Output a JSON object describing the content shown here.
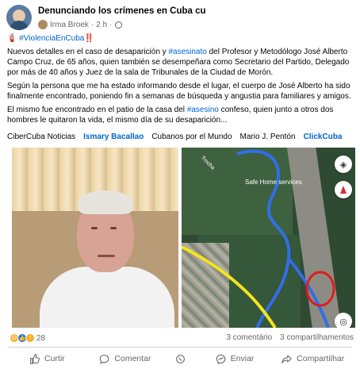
{
  "header": {
    "group_name": "Denunciando los crímenes en Cuba cu",
    "author": "Irma Broek",
    "time": "2 h"
  },
  "post": {
    "hashtag_line": "#ViolenciaEnCuba",
    "emoji_marks": "‼️",
    "paragraph1_a": "Nuevos detalles en el caso de desaparición y ",
    "paragraph1_tag": "#asesinato",
    "paragraph1_b": " del Profesor y Metodólogo José Alberto Campo Cruz, de 65 años, quien también se desempeñara como Secretario del Partido, Delegado por más de 40 años y Juez de la sala de Tribunales de la Ciudad de Morón.",
    "paragraph2": "Según la persona que me ha estado informando desde el lugar, el cuerpo de José Alberto ha sido finalmente encontrado, poniendo fin a semanas de búsqueda y angustia para familiares y amigos.",
    "paragraph3_a": "El mismo fue encontrado en el patio de la casa del  ",
    "paragraph3_tag": "#asesino",
    "paragraph3_b": " confeso, quien junto a otros dos hombres le quitaron la vida, el mismo día de su desaparición..."
  },
  "tags": [
    {
      "label": "CiberCuba Noticias",
      "link": false
    },
    {
      "label": "Ismary Bacallao",
      "link": true
    },
    {
      "label": "Cubanos por el Mundo",
      "link": false
    },
    {
      "label": "Mario J. Pentón",
      "link": false
    },
    {
      "label": "ClickCuba",
      "link": true
    }
  ],
  "map": {
    "place_label": "Safe Home services",
    "road_label": "Trocha"
  },
  "reactions": {
    "count": "28",
    "comments": "3 comentário",
    "shares": "3 compartilhamentos"
  },
  "actions": {
    "like": "Curtir",
    "comment": "Comentar",
    "send": "Enviar",
    "share": "Compartilhar"
  },
  "colors": {
    "link": "#0064d1",
    "muted": "#65676b",
    "route_blue": "#2f6fe8",
    "route_yellow": "#f5e31c",
    "marker_red": "#e11c1c"
  },
  "icons": [
    "globe-icon",
    "layers-icon",
    "compass-icon",
    "locate-icon",
    "like-icon",
    "comment-icon",
    "whatsapp-icon",
    "send-icon",
    "share-icon"
  ]
}
